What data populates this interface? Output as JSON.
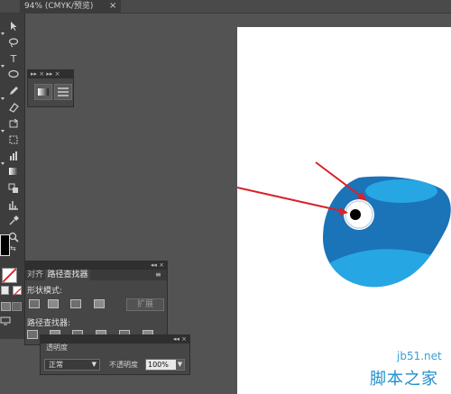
{
  "document": {
    "tab_title": "94% (CMYK/预览)",
    "close_glyph": "×"
  },
  "toolbar": {
    "tools": [
      "selection-tool-icon",
      "lasso-tool-icon",
      "type-tool-icon",
      "ellipse-tool-icon",
      "pencil-tool-icon",
      "eraser-tool-icon",
      "rotate-tool-icon",
      "free-transform-tool-icon",
      "graph-tool-icon",
      "gradient-tool-icon",
      "blend-tool-icon",
      "chart-tool-icon",
      "eyedropper-tool-icon",
      "zoom-tool-icon"
    ],
    "type_tool_glyph": "T"
  },
  "mini_panel": {
    "header_glyphs": "▸▸ ×  ▸▸ ×"
  },
  "pathfinder": {
    "header_glyphs": "◂◂ ×",
    "tab_align": "对齐",
    "tab_pathfinder": "路径查找器",
    "menu_glyph": "≡",
    "shape_modes_label": "形状模式:",
    "pathfinders_label": "路径查找器:",
    "expand_button": "扩展"
  },
  "transparency": {
    "header_glyphs": "◂◂ ×",
    "tab_label": "透明度",
    "blend_mode": "正常",
    "opacity_label": "不透明度",
    "opacity_value": "100%",
    "dropdown_glyph": "▼"
  },
  "watermark": {
    "site": "jb51.net",
    "name": "脚本之家"
  },
  "colors": {
    "bird_dark": "#1b73b8",
    "bird_light": "#27a6e4",
    "arrow": "#d8222a",
    "eye_white": "#ffffff",
    "eye_ring": "#bcd0e0",
    "pupil": "#000000"
  }
}
